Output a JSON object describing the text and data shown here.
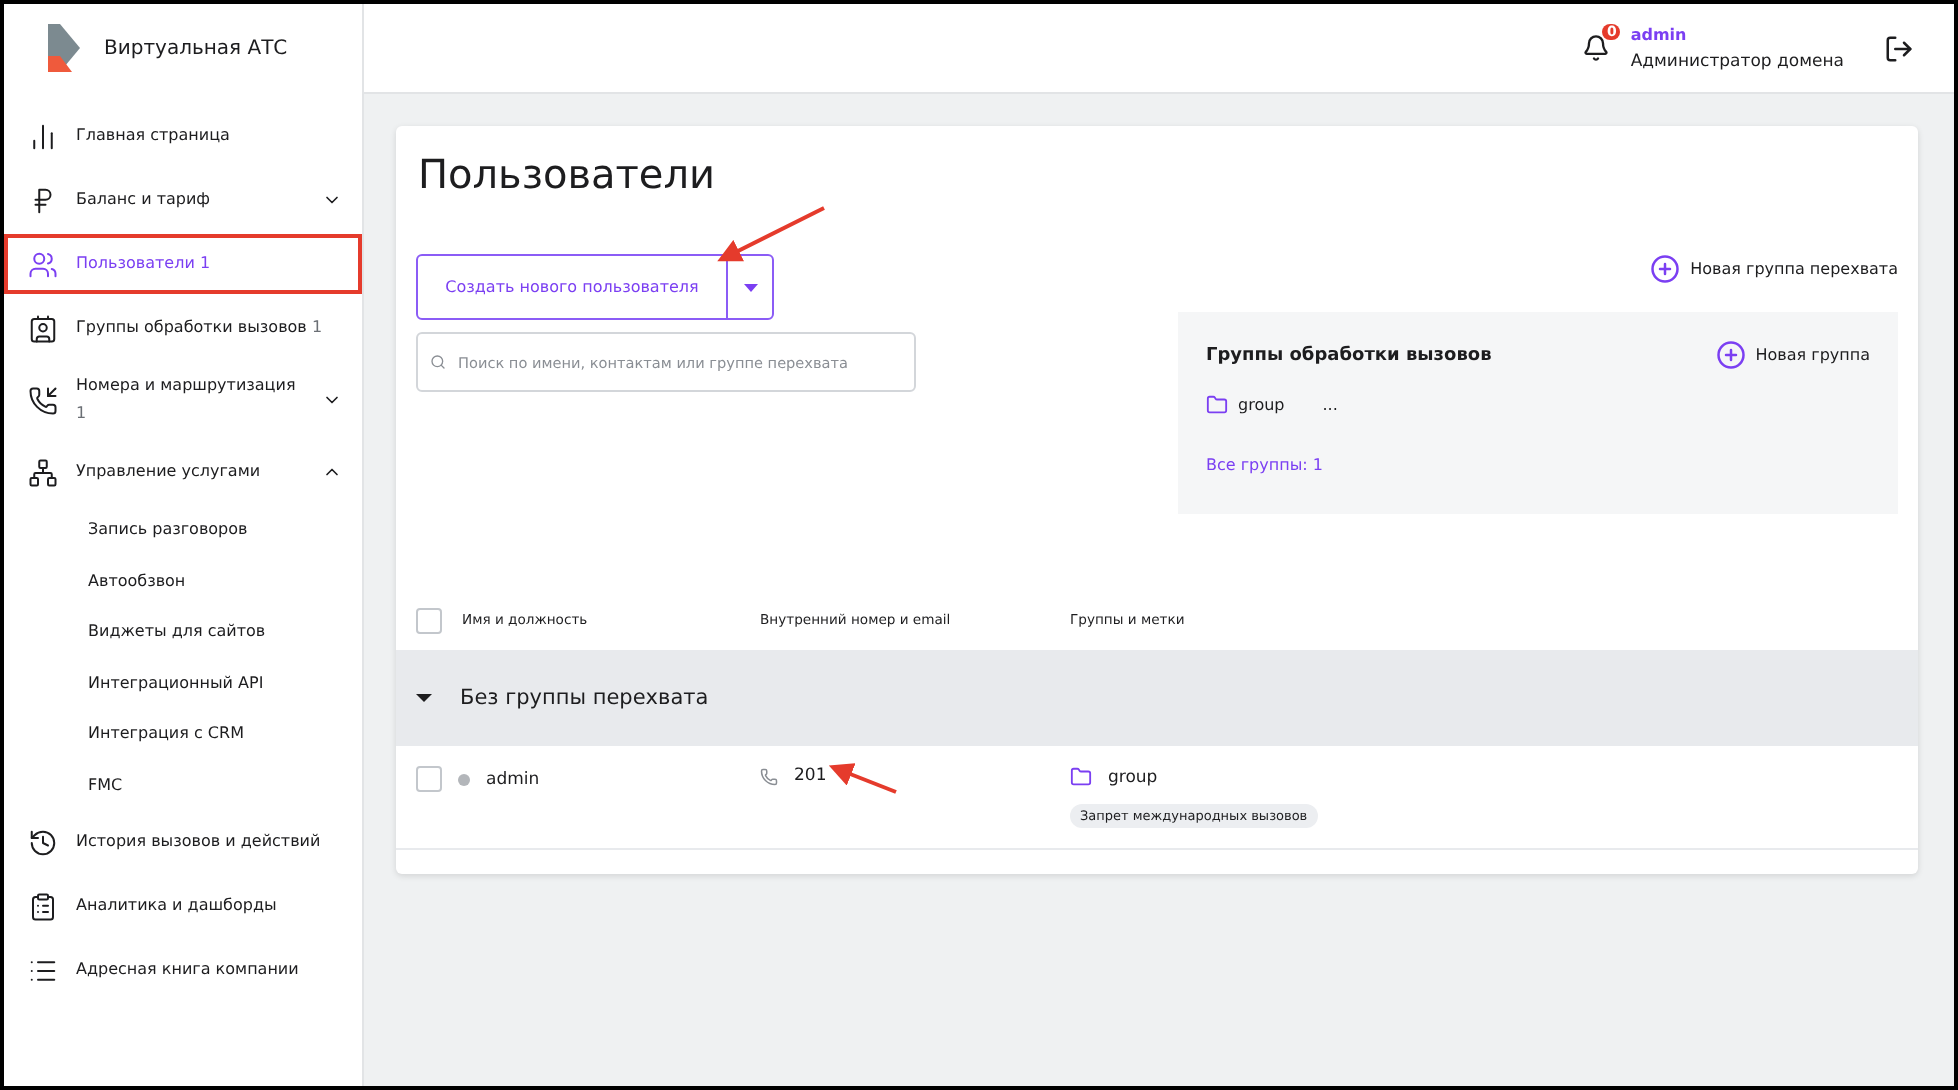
{
  "brand": {
    "title": "Виртуальная АТС"
  },
  "sidebar": {
    "items": [
      {
        "label": "Главная страница",
        "selected": false,
        "annotated": false
      },
      {
        "label": "Баланс и тариф",
        "selected": false,
        "annotated": false,
        "expanded": false
      },
      {
        "label": "Пользователи",
        "count": "1",
        "selected": true,
        "annotated": true
      },
      {
        "label": "Группы обработки вызовов",
        "count": "1",
        "selected": false,
        "annotated": false
      },
      {
        "label": "Номера и маршрутизация",
        "count": "1",
        "selected": false,
        "annotated": false,
        "expanded": false
      },
      {
        "label": "Управление услугами",
        "selected": false,
        "annotated": false,
        "expanded": true,
        "children": [
          {
            "label": "Запись разговоров"
          },
          {
            "label": "Автообзвон"
          },
          {
            "label": "Виджеты для сайтов"
          },
          {
            "label": "Интеграционный API"
          },
          {
            "label": "Интеграция с CRM"
          },
          {
            "label": "FMC"
          }
        ]
      },
      {
        "label": "История вызовов и действий",
        "selected": false,
        "annotated": false
      },
      {
        "label": "Аналитика и дашборды",
        "selected": false,
        "annotated": false
      },
      {
        "label": "Адресная книга компании",
        "selected": false,
        "annotated": false
      }
    ]
  },
  "header": {
    "notifications": "0",
    "user": "admin",
    "role": "Администратор домена"
  },
  "page": {
    "title": "Пользователи",
    "create_button": "Создать нового пользователя",
    "new_pickup_group": "Новая группа перехвата",
    "search": {
      "placeholder": "Поиск по имени, контактам или группе перехвата"
    },
    "groups_panel": {
      "title": "Группы обработки вызовов",
      "new_group": "Новая группа",
      "groups": [
        {
          "name": "group",
          "more": "..."
        }
      ],
      "all_link": "Все группы: 1"
    },
    "table": {
      "select_all_checked": false,
      "columns": [
        "Имя и должность",
        "Внутренний номер и email",
        "Группы и метки"
      ],
      "sections": [
        {
          "title": "Без группы перехвата",
          "expanded": true,
          "rows": [
            {
              "checked": false,
              "name": "admin",
              "online": false,
              "extension": "201",
              "group": "group",
              "tag": "Запрет международных вызовов"
            }
          ]
        }
      ]
    }
  }
}
